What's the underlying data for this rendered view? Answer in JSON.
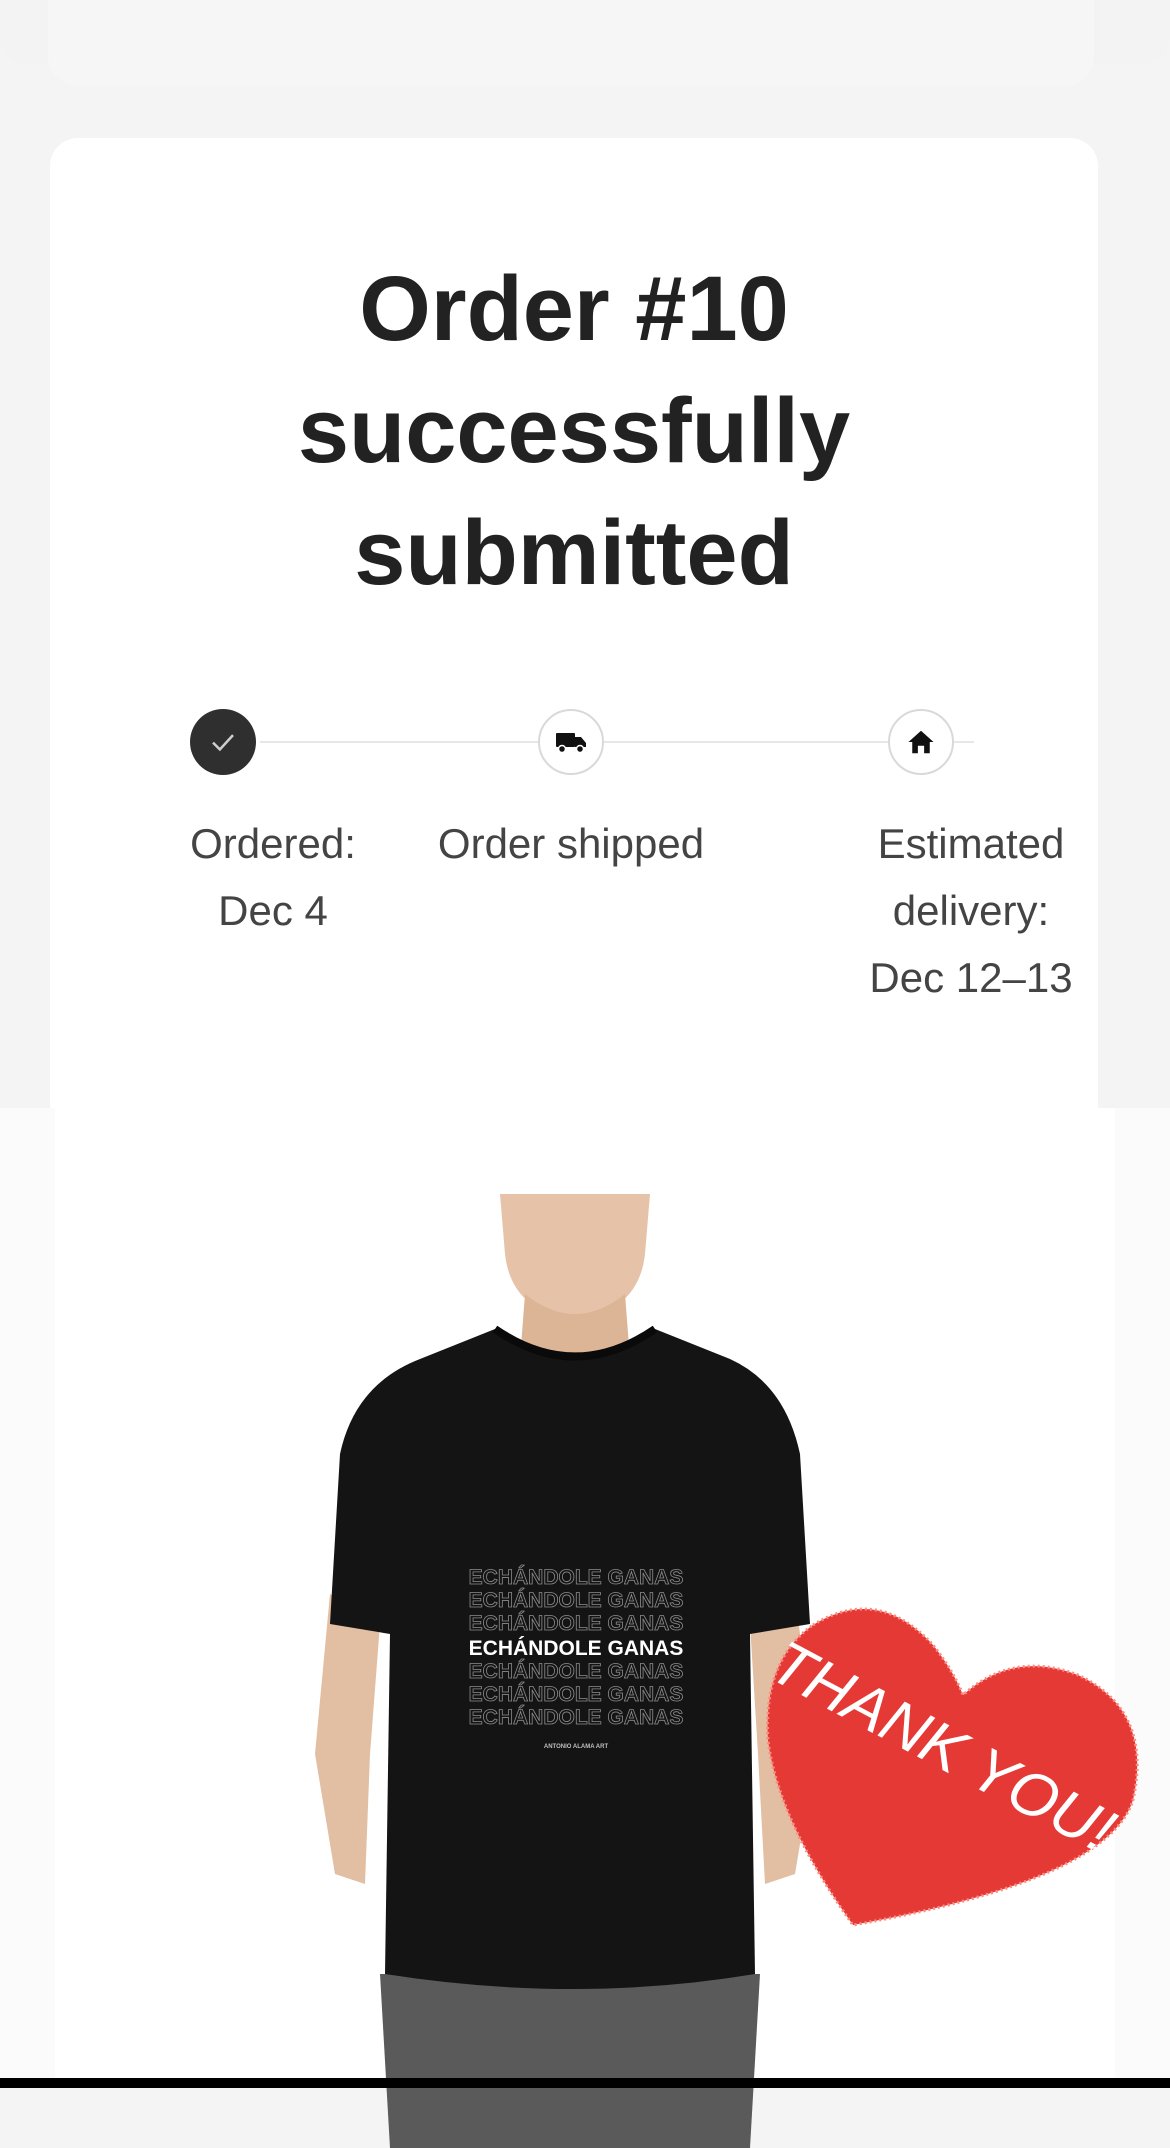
{
  "order": {
    "title_line1": "Order #10",
    "title_line2": "successfully",
    "title_line3": "submitted"
  },
  "progress": {
    "completed_steps": 1,
    "total_steps": 3,
    "steps": [
      {
        "icon": "checkmark-icon",
        "label_line1": "Ordered:",
        "label_line2": "Dec 4",
        "state": "done"
      },
      {
        "icon": "truck-icon",
        "label_line1": "Order shipped",
        "state": "pending"
      },
      {
        "icon": "home-icon",
        "label_line1": "Estimated",
        "label_line2": "delivery:",
        "label_line3": "Dec 12–13",
        "state": "pending"
      }
    ]
  },
  "product": {
    "shirt_print_line": "ECHÁNDOLE GANAS",
    "shirt_print_small": "ANTONIO ALAMA ART",
    "sticker_text": "THANK YOU!",
    "colors": {
      "shirt": "#141414",
      "sticker": "#e53935"
    }
  }
}
